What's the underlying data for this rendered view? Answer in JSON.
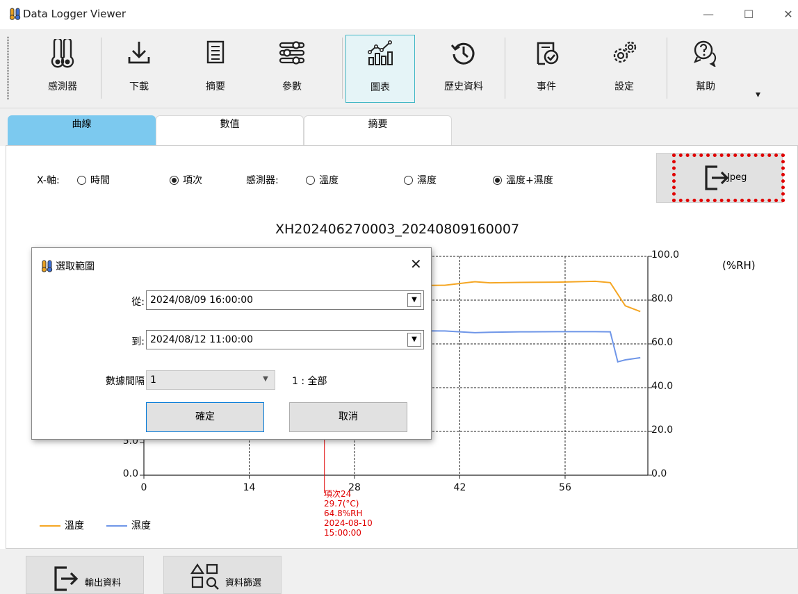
{
  "window": {
    "title": "Data Logger Viewer",
    "minimize_glyph": "—",
    "maximize_glyph": "☐",
    "close_glyph": "✕"
  },
  "toolbar": {
    "items": [
      {
        "label": "感測器",
        "icon": "thermometer-pair-icon"
      },
      {
        "label": "下載",
        "icon": "download-icon"
      },
      {
        "label": "摘要",
        "icon": "summary-list-icon"
      },
      {
        "label": "參數",
        "icon": "sliders-icon"
      },
      {
        "label": "圖表",
        "icon": "chart-icon",
        "active": true
      },
      {
        "label": "歷史資料",
        "icon": "history-icon"
      },
      {
        "label": "事件",
        "icon": "event-check-icon"
      },
      {
        "label": "設定",
        "icon": "gears-icon"
      },
      {
        "label": "幫助",
        "icon": "help-chat-icon"
      }
    ],
    "overflow_glyph": "▼"
  },
  "tabs": [
    {
      "label": "曲線",
      "active": true
    },
    {
      "label": "數值"
    },
    {
      "label": "摘要"
    }
  ],
  "options": {
    "x_axis_label": "X-軸:",
    "x_time": "時間",
    "x_index": "項次",
    "x_selected": "項次",
    "sensor_label": "感測器:",
    "sensor_temp": "溫度",
    "sensor_hum": "濕度",
    "sensor_both": "溫度+濕度",
    "sensor_selected": "溫度+濕度"
  },
  "jpeg_button": {
    "label": "Jpeg",
    "icon": "export-icon"
  },
  "chart_data": {
    "type": "line",
    "title": "XH202406270003_20240809160007",
    "x_ticks": [
      "0",
      "14",
      "28",
      "42",
      "56"
    ],
    "xlim": [
      0,
      67
    ],
    "left_ticks_visible": [
      "5.0",
      "0.0"
    ],
    "right_ticks": [
      "100.0",
      "80.0",
      "60.0",
      "40.0",
      "20.0",
      "0.0"
    ],
    "right_unit": "(%RH)",
    "ylim_right": [
      0,
      100
    ],
    "grid": true,
    "legend_position": "bottom-left",
    "series": [
      {
        "name": "溫度",
        "color": "#f5a623",
        "axis": "left-hidden-scale",
        "x": [
          0,
          40,
          44,
          46,
          50,
          55,
          60,
          62,
          64,
          66
        ],
        "y": [
          85.5,
          86.8,
          88.4,
          87.9,
          88.1,
          88.2,
          88.6,
          88.0,
          77.4,
          74.8
        ]
      },
      {
        "name": "濕度",
        "color": "#6f96e8",
        "axis": "right",
        "x": [
          0,
          40,
          44,
          46,
          50,
          55,
          60,
          62,
          63,
          64,
          66
        ],
        "y": [
          66.5,
          65.9,
          65.1,
          65.3,
          65.5,
          65.6,
          65.6,
          65.5,
          51.8,
          52.7,
          53.7
        ]
      }
    ],
    "cursor": {
      "x": 24,
      "lines": [
        "項次24",
        "29.7(°C)",
        "64.8%RH",
        "2024-08-10",
        "15:00:00"
      ]
    }
  },
  "bottom_buttons": [
    {
      "label": "輸出資料",
      "icon": "export-icon"
    },
    {
      "label": "資料篩選",
      "icon": "shapes-search-icon"
    }
  ],
  "dialog": {
    "title": "選取範圍",
    "from_label": "從:",
    "from_value": "2024/08/09 16:00:00",
    "to_label": "到:",
    "to_value": "2024/08/12 11:00:00",
    "interval_label": "數據間隔",
    "interval_value": "1",
    "interval_hint": "1 : 全部",
    "ok_label": "確定",
    "cancel_label": "取消",
    "close_glyph": "✕",
    "dropdown_glyph": "▼"
  }
}
